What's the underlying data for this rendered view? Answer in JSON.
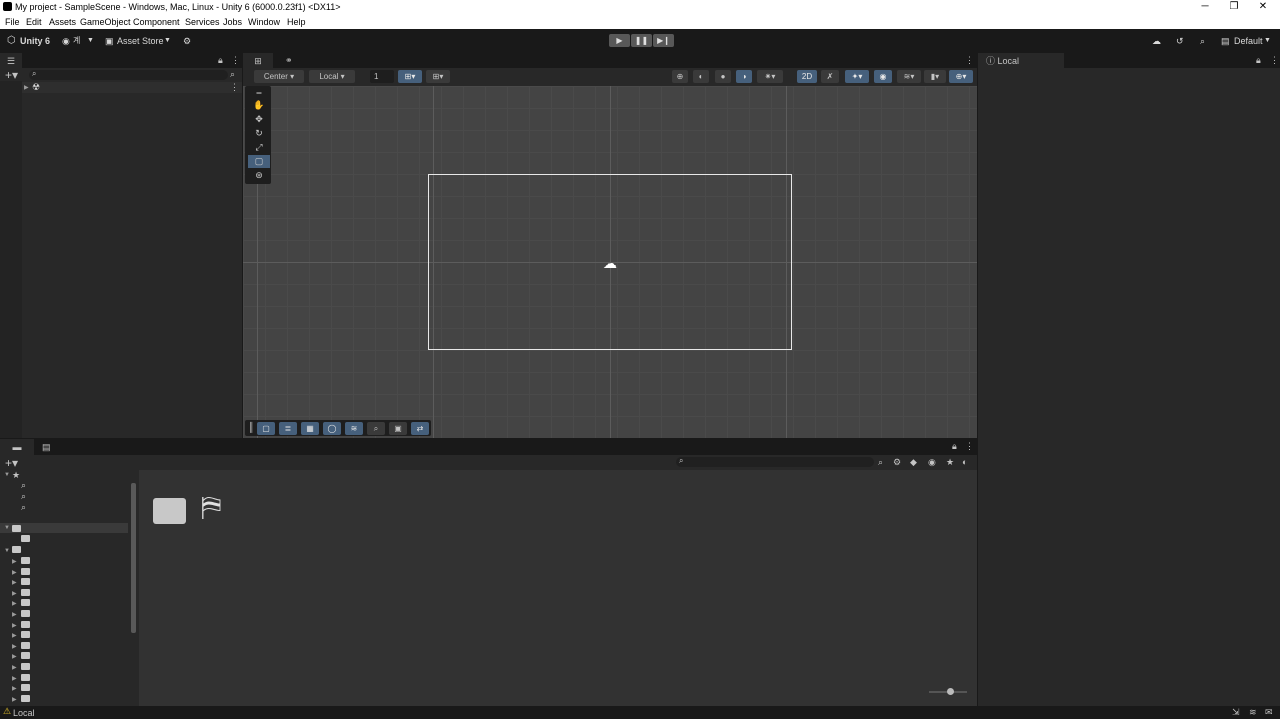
{
  "window": {
    "title": "My project - SampleScene - Windows, Mac, Linux - Unity 6 (6000.0.23f1) <DX11>",
    "minimize": "─",
    "maximize": "❐",
    "close": "✕"
  },
  "menu": [
    "File",
    "Edit",
    "Assets",
    "GameObject",
    "Component",
    "Services",
    "Jobs",
    "Window",
    "Help"
  ],
  "toolbar": {
    "product": "Unity 6",
    "account": "▼",
    "asset_store": "Asset Store",
    "layout": "Default"
  },
  "scene": {
    "pivot": "Center",
    "space": "Local",
    "grid_snap": "1",
    "mode_2d": "2D"
  },
  "inspector": {
    "tab": "Local"
  },
  "status": {
    "text": "Local"
  },
  "colors": {
    "accent": "#46607c",
    "panel": "#282828",
    "bar": "#191919",
    "scene_bg": "#444444"
  }
}
